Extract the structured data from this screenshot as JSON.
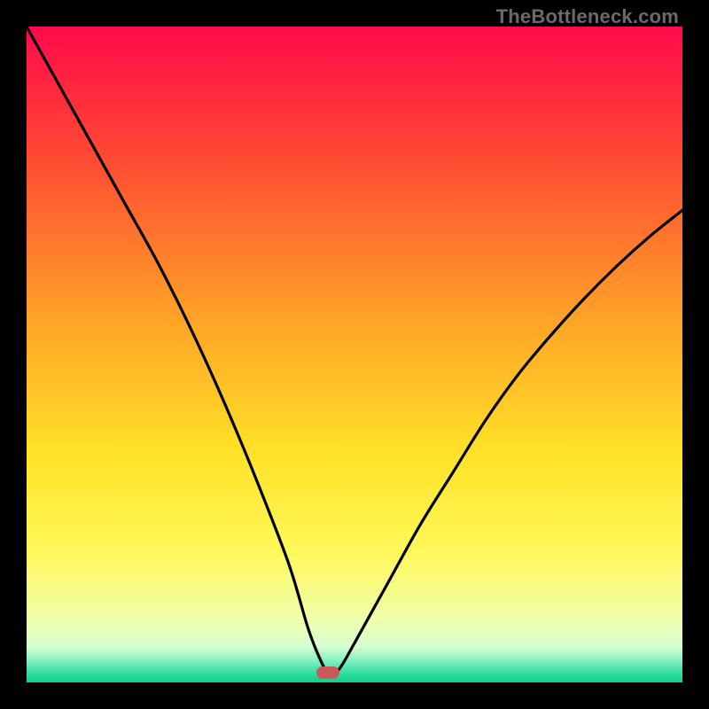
{
  "watermark": "TheBottleneck.com",
  "colors": {
    "frame_bg": "#000000",
    "curve": "#000000",
    "marker": "#c85a5a",
    "gradient_stops": [
      {
        "offset": 0.0,
        "color": "#ff0a4a"
      },
      {
        "offset": 0.2,
        "color": "#ff4a33"
      },
      {
        "offset": 0.45,
        "color": "#ffa427"
      },
      {
        "offset": 0.65,
        "color": "#ffe227"
      },
      {
        "offset": 0.8,
        "color": "#fff85a"
      },
      {
        "offset": 0.9,
        "color": "#f1ffa8"
      },
      {
        "offset": 0.945,
        "color": "#d6ffd0"
      },
      {
        "offset": 0.965,
        "color": "#8bf2c4"
      },
      {
        "offset": 0.985,
        "color": "#34e0a0"
      },
      {
        "offset": 1.0,
        "color": "#12d185"
      }
    ]
  },
  "chart_data": {
    "type": "line",
    "title": "",
    "xlabel": "",
    "ylabel": "",
    "xlim": [
      0,
      100
    ],
    "ylim": [
      0,
      100
    ],
    "marker": {
      "x": 46,
      "y": 1.5
    },
    "series": [
      {
        "name": "bottleneck-curve",
        "x": [
          0,
          5,
          10,
          15,
          20,
          25,
          30,
          35,
          40,
          43,
          45,
          46,
          47,
          48,
          50,
          55,
          60,
          65,
          70,
          75,
          80,
          85,
          90,
          95,
          100
        ],
        "values": [
          100,
          91,
          82,
          73,
          64,
          54,
          43,
          31,
          18,
          8,
          3,
          1.5,
          1.5,
          2.5,
          6,
          15,
          24,
          32,
          40,
          47,
          53,
          58.5,
          63.5,
          68,
          72
        ]
      }
    ]
  }
}
